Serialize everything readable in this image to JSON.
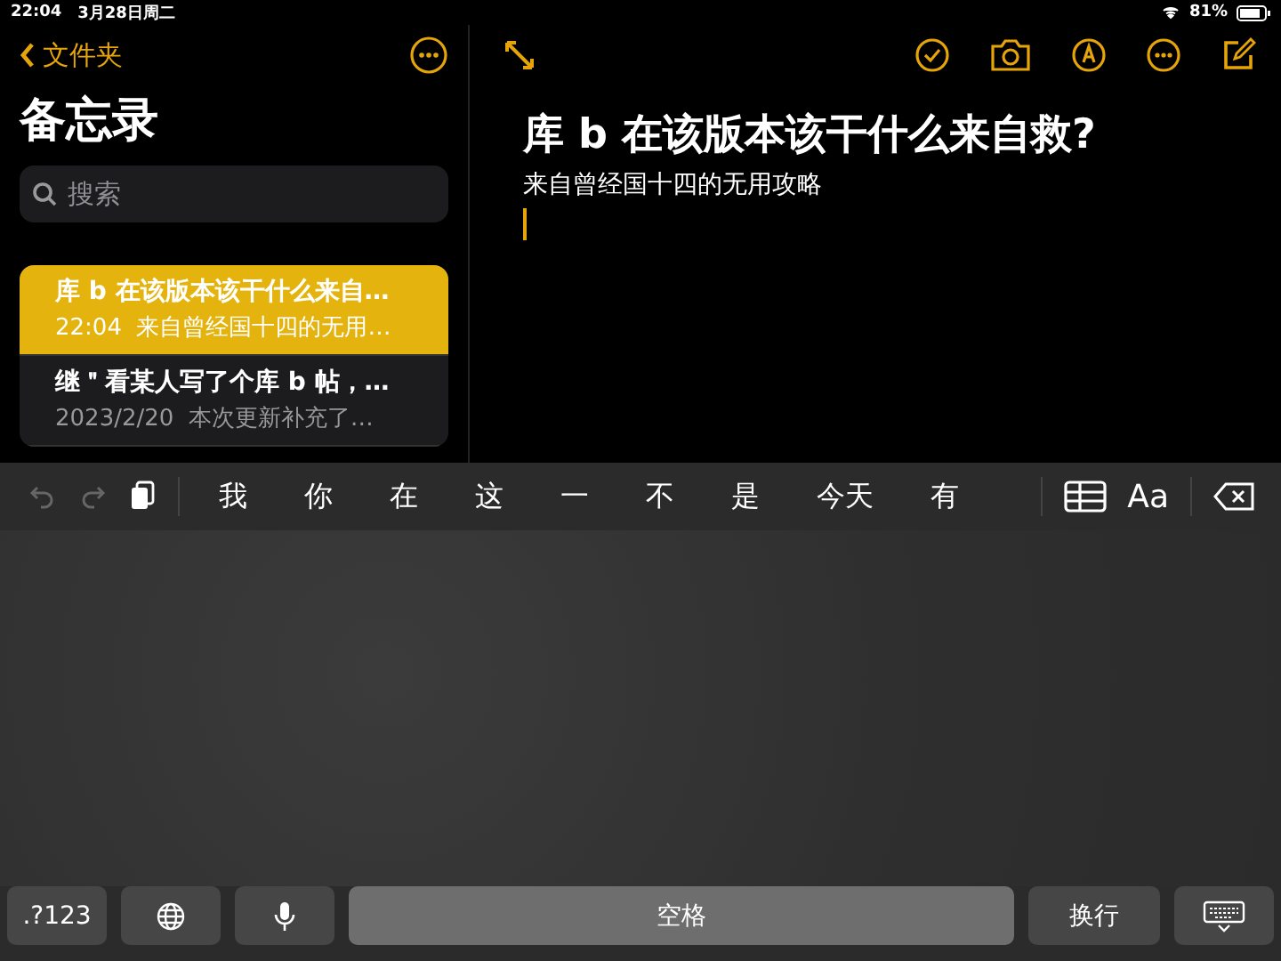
{
  "status_bar": {
    "time": "22:04",
    "date": "3月28日周二",
    "battery_text": "81%"
  },
  "sidebar": {
    "back_label": "文件夹",
    "title": "备忘录",
    "search": {
      "placeholder": "搜索"
    },
    "notes": [
      {
        "title": "库 **b** 在该版本该干什么来自…",
        "time": "22:04",
        "preview": "来自曾经国十四的无用…",
        "selected": true
      },
      {
        "title": "继＂看某人写了个库 **b** 帖，…",
        "time": "2023/2/20",
        "preview": "本次更新补充了…",
        "selected": false
      }
    ]
  },
  "note": {
    "title": "库 **b** 在该版本该干什么来自救?",
    "body": "来自曾经国十四的无用攻略"
  },
  "keyboard": {
    "undo_disabled": true,
    "redo_disabled": true,
    "candidates": [
      "我",
      "你",
      "在",
      "这",
      "一",
      "不",
      "是",
      "今天",
      "有"
    ],
    "format_label": "Aa",
    "keys": [
      {
        "kind": "text",
        "label": ".?123"
      },
      {
        "kind": "globe"
      },
      {
        "kind": "mic"
      },
      {
        "kind": "space",
        "label": "空格"
      },
      {
        "kind": "text",
        "label": "换行"
      },
      {
        "kind": "hide"
      }
    ]
  }
}
